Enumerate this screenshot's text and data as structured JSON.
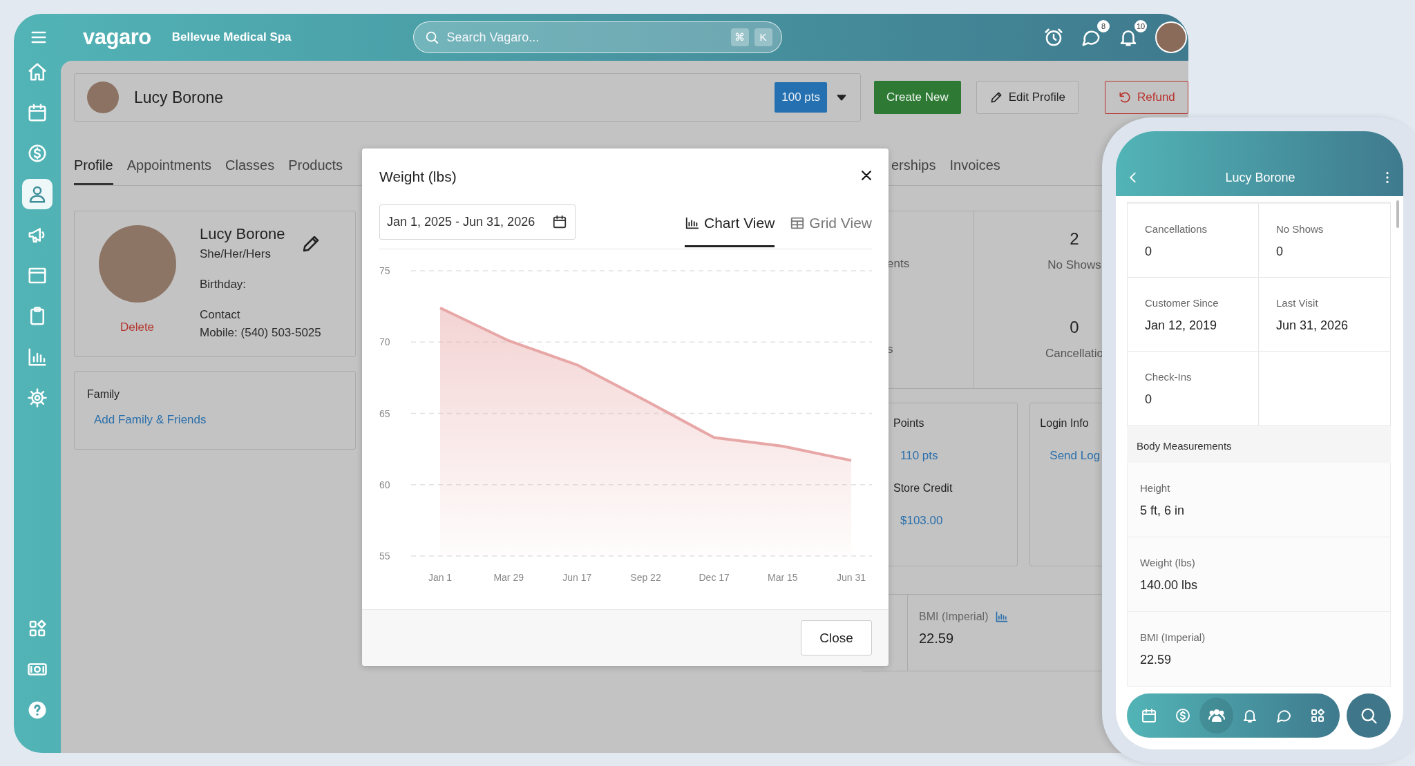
{
  "top_bar": {
    "logo": "vagaro",
    "business": "Bellevue Medical Spa",
    "search": {
      "placeholder": "Search Vagaro...",
      "shortcut_keys": [
        "⌘",
        "K"
      ]
    },
    "icons": [
      {
        "kind": "alarm"
      },
      {
        "kind": "chat",
        "badge": "8"
      },
      {
        "kind": "bell",
        "badge": "10"
      },
      {
        "kind": "avatar"
      }
    ]
  },
  "sidebar": {
    "items": [
      {
        "kind": "home",
        "selected": false
      },
      {
        "kind": "calendar",
        "selected": false
      },
      {
        "kind": "dollar",
        "selected": false
      },
      {
        "kind": "person",
        "selected": true
      },
      {
        "kind": "megaphone",
        "selected": false
      },
      {
        "kind": "browser",
        "selected": false
      },
      {
        "kind": "clipboard",
        "selected": false
      },
      {
        "kind": "chart",
        "selected": false
      },
      {
        "kind": "gear",
        "selected": false
      }
    ],
    "bottom_items": [
      {
        "kind": "apps",
        "selected": false
      },
      {
        "kind": "cash",
        "selected": false
      },
      {
        "kind": "help",
        "selected": false
      }
    ]
  },
  "customer_header": {
    "name": "Lucy Borone",
    "points_badge": "100 pts",
    "buttons": [
      {
        "kind": "create",
        "label": "Create New"
      },
      {
        "kind": "edit",
        "label": "Edit Profile"
      },
      {
        "kind": "refund",
        "label": "Refund"
      }
    ]
  },
  "tabs": [
    {
      "label": "Profile",
      "selected": true
    },
    {
      "label": "Appointments",
      "selected": false
    },
    {
      "label": "Classes",
      "selected": false
    },
    {
      "label": "Products",
      "selected": false
    }
  ],
  "tabs_right_of_dialog": [
    {
      "label": "erships",
      "selected": false
    },
    {
      "label": "Invoices",
      "selected": false
    }
  ],
  "profile_card": {
    "name": "Lucy Borone",
    "pronouns": "She/Her/Hers",
    "birthday_label": "Birthday:",
    "contact_label": "Contact",
    "mobile": "Mobile: (540) 503-5025",
    "delete_link": "Delete"
  },
  "family_card": {
    "title": "Family",
    "link": "Add Family & Friends"
  },
  "stats": [
    {
      "label": "ents"
    },
    {
      "value": "2",
      "label": "No Shows"
    },
    {
      "label": "s"
    },
    {
      "value": "0",
      "label": "Cancellatio"
    }
  ],
  "points_card": {
    "title": "Points",
    "points": "110 pts",
    "credit_title": "Store Credit",
    "credit": "$103.00"
  },
  "login_card": {
    "title": "Login Info",
    "link": "Send Log"
  },
  "bmi": {
    "label": "BMI (Imperial)",
    "value": "22.59"
  },
  "dialog": {
    "title": "Weight (lbs)",
    "date_range": "Jan 1, 2025 - Jun 31, 2026",
    "views": [
      {
        "kind": "chart",
        "label": "Chart View",
        "selected": true
      },
      {
        "kind": "grid",
        "label": "Grid View",
        "selected": false
      }
    ],
    "chart_data": {
      "type": "area",
      "categories": [
        "Jan 1",
        "Mar 29",
        "Jun 17",
        "Sep 22",
        "Dec 17",
        "Mar 15",
        "Jun 31"
      ],
      "series": [
        {
          "color": "#e8a7a7",
          "values": [
            72.4,
            70.1,
            68.4,
            65.9,
            63.3,
            62.7,
            61.7
          ]
        }
      ],
      "ylim": [
        55,
        75
      ],
      "yticks": [
        55,
        60,
        65,
        70,
        75
      ],
      "grid": true
    },
    "close_button": "Close"
  },
  "phone": {
    "title": "Lucy Borone",
    "stats": [
      {
        "label": "Cancellations",
        "value": "0"
      },
      {
        "label": "No Shows",
        "value": "0"
      },
      {
        "label": "Customer Since",
        "value": "Jan 12, 2019"
      },
      {
        "label": "Last Visit",
        "value": "Jun 31, 2026"
      },
      {
        "label": "Check-Ins",
        "value": "0"
      }
    ],
    "section_title": "Body Measurements",
    "measurements": [
      {
        "label": "Height",
        "value": "5 ft, 6 in"
      },
      {
        "label": "Weight (lbs)",
        "value": "140.00 lbs"
      },
      {
        "label": "BMI (Imperial)",
        "value": "22.59"
      }
    ],
    "nav": [
      {
        "kind": "calendar",
        "selected": false
      },
      {
        "kind": "dollar",
        "selected": false
      },
      {
        "kind": "people",
        "selected": true
      },
      {
        "kind": "bell",
        "selected": false
      },
      {
        "kind": "chat",
        "selected": false
      },
      {
        "kind": "apps",
        "selected": false
      }
    ]
  }
}
